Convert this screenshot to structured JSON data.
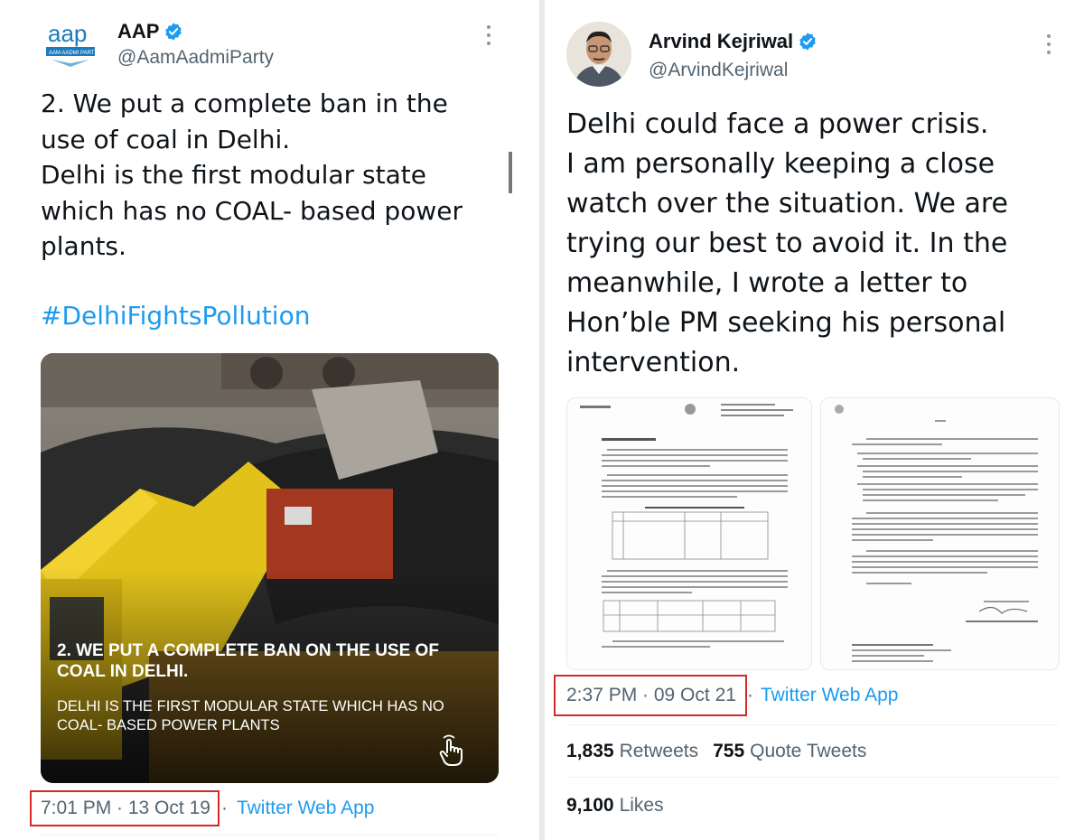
{
  "left_tweet": {
    "name": "AAP",
    "handle": "@AamAadmiParty",
    "avatar_logo_text": "aap",
    "avatar_banner_text": "AAM AADMI PARTY",
    "body": "2. We put a complete ban in the\nuse of coal in Delhi.\nDelhi is the first modular state\nwhich has no COAL- based power\nplants.",
    "hashtag": "#DelhiFightsPollution",
    "media": {
      "headline": "2. WE PUT A COMPLETE BAN ON THE USE OF COAL IN DELHI.",
      "subline": "DELHI IS THE FIRST MODULAR STATE WHICH HAS NO COAL- BASED POWER PLANTS"
    },
    "time": "7:01 PM · 13 Oct 19",
    "source": "Twitter Web App"
  },
  "right_tweet": {
    "name": "Arvind Kejriwal",
    "handle": "@ArvindKejriwal",
    "body": "Delhi could face a power crisis.\nI am personally keeping a close\nwatch over the situation. We are\ntrying our best to avoid it. In the\nmeanwhile, I wrote a letter to\nHon’ble PM seeking his personal\nintervention.",
    "time": "2:37 PM · 09 Oct 21",
    "source": "Twitter Web App",
    "stats": {
      "retweets_count": "1,835",
      "retweets_label": "Retweets",
      "quotes_count": "755",
      "quotes_label": "Quote Tweets",
      "likes_count": "9,100",
      "likes_label": "Likes"
    }
  },
  "colors": {
    "link": "#1d9bf0",
    "secondary_text": "#536471",
    "highlight_box": "#d62828",
    "verified": "#1d9bf0"
  },
  "icons": [
    "verified-badge-icon",
    "more-options-icon",
    "hand-pointer-icon"
  ]
}
